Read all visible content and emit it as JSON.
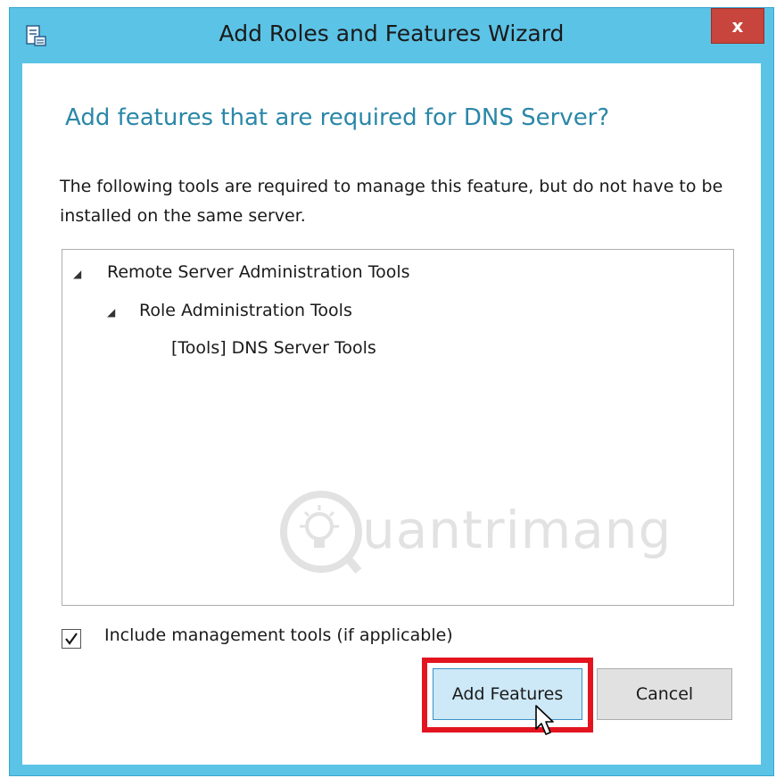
{
  "window": {
    "title": "Add Roles and Features Wizard",
    "close_glyph": "x",
    "app_icon": "server-manager-icon"
  },
  "dialog": {
    "heading": "Add features that are required for DNS Server?",
    "description": "The following tools are required to manage this feature, but do not have to be installed on the same server."
  },
  "tree": {
    "items": [
      {
        "label": "Remote Server Administration Tools",
        "expanded": true,
        "level": 0
      },
      {
        "label": "Role Administration Tools",
        "expanded": true,
        "level": 1
      },
      {
        "label": "[Tools] DNS Server Tools",
        "expanded": null,
        "level": 2
      }
    ]
  },
  "options": {
    "include_management_tools_label": "Include management tools (if applicable)",
    "include_management_tools_checked": true
  },
  "buttons": {
    "add_features_label": "Add Features",
    "cancel_label": "Cancel"
  },
  "watermark": {
    "text": "uantrimang"
  },
  "colors": {
    "window_frame": "#5bc3e6",
    "heading": "#2a87a8",
    "close_button": "#c7453c",
    "highlight_box": "#e3141f",
    "primary_button": "#cde8f7"
  }
}
